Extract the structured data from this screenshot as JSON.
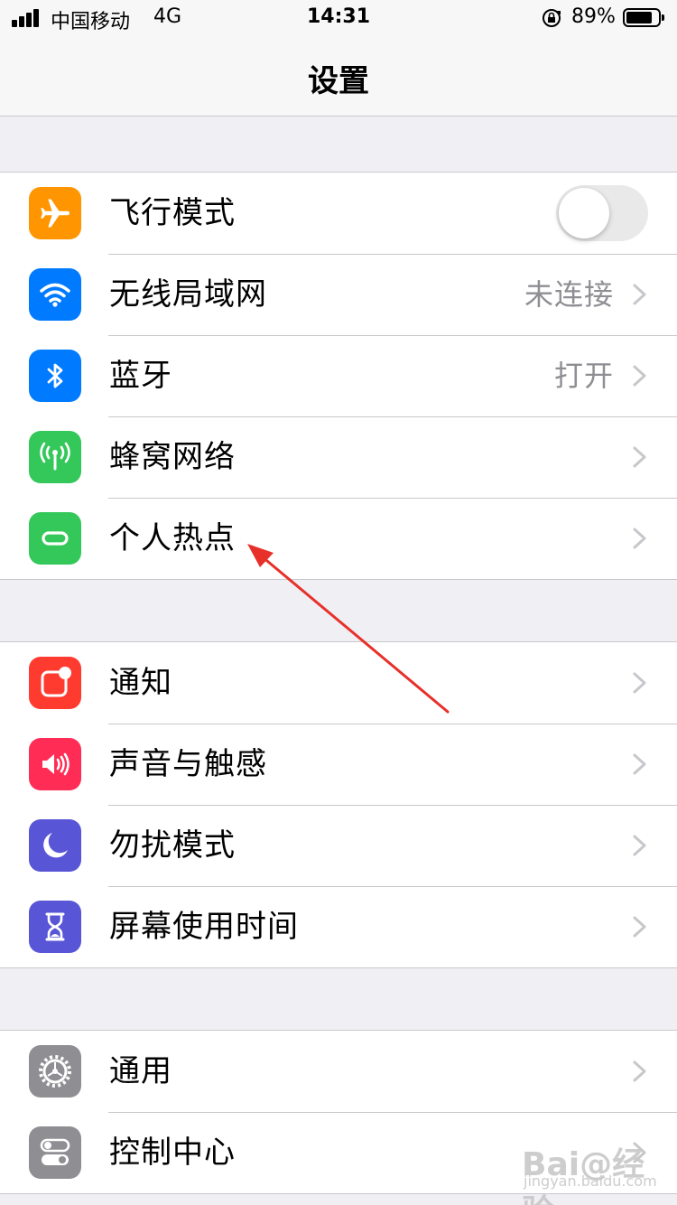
{
  "status_bar": {
    "carrier": "中国移动",
    "network": "4G",
    "time": "14:31",
    "battery_percent_label": "89%",
    "battery_level": 0.89
  },
  "nav": {
    "title": "设置"
  },
  "groups": [
    {
      "rows": [
        {
          "label": "飞行模式",
          "icon": "airplane-icon",
          "icon_color": "#ff9500",
          "toggle": false
        },
        {
          "label": "无线局域网",
          "icon": "wifi-icon",
          "icon_color": "#007aff",
          "value": "未连接"
        },
        {
          "label": "蓝牙",
          "icon": "bluetooth-icon",
          "icon_color": "#007aff",
          "value": "打开"
        },
        {
          "label": "蜂窝网络",
          "icon": "cellular-icon",
          "icon_color": "#34c759"
        },
        {
          "label": "个人热点",
          "icon": "hotspot-icon",
          "icon_color": "#34c759"
        }
      ]
    },
    {
      "rows": [
        {
          "label": "通知",
          "icon": "notifications-icon",
          "icon_color": "#ff3b30"
        },
        {
          "label": "声音与触感",
          "icon": "sound-icon",
          "icon_color": "#ff2d55"
        },
        {
          "label": "勿扰模式",
          "icon": "moon-icon",
          "icon_color": "#5856d6"
        },
        {
          "label": "屏幕使用时间",
          "icon": "hourglass-icon",
          "icon_color": "#5856d6"
        }
      ]
    },
    {
      "rows": [
        {
          "label": "通用",
          "icon": "gear-icon",
          "icon_color": "#8e8e93"
        },
        {
          "label": "控制中心",
          "icon": "switches-icon",
          "icon_color": "#8e8e93"
        }
      ]
    }
  ],
  "annotation": {
    "arrow_color": "#e8302a"
  },
  "watermark": {
    "main": "Bai@经验",
    "sub": "jingyan.baidu.com"
  }
}
